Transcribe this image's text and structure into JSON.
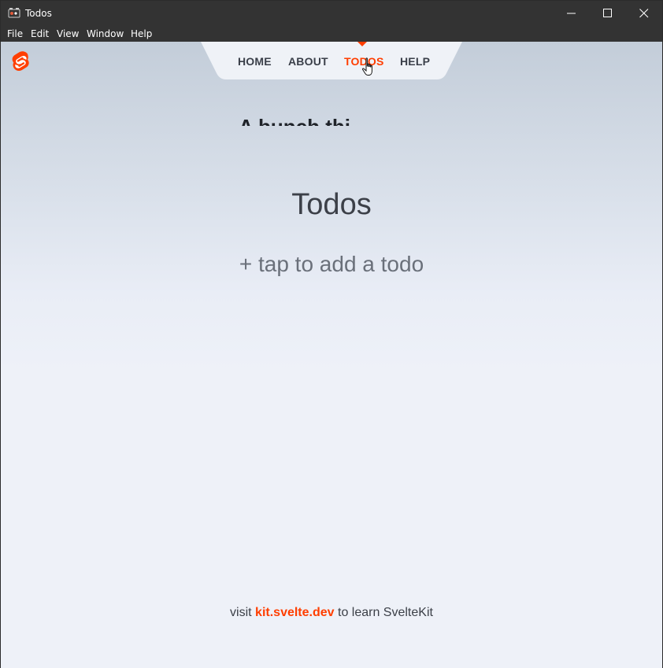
{
  "window": {
    "title": "Todos",
    "controls": [
      "minimize",
      "maximize",
      "close"
    ]
  },
  "menu": {
    "items": [
      "File",
      "Edit",
      "View",
      "Window",
      "Help"
    ]
  },
  "nav": {
    "items": [
      {
        "label": "HOME",
        "active": false
      },
      {
        "label": "ABOUT",
        "active": false
      },
      {
        "label": "TODOS",
        "active": true
      },
      {
        "label": "HELP",
        "active": false
      }
    ]
  },
  "page": {
    "ghost_text": "A bunch thi",
    "title": "Todos",
    "add_prompt": "+ tap to add a todo"
  },
  "footer": {
    "prefix": "visit ",
    "link": "kit.svelte.dev",
    "suffix": " to learn SvelteKit"
  },
  "colors": {
    "accent": "#ff3e00",
    "titlebar": "#333333",
    "background": "#eef1f8"
  },
  "icons": [
    "app-icon",
    "svelte-logo-icon",
    "minimize-icon",
    "maximize-icon",
    "close-icon",
    "pointer-cursor-icon"
  ]
}
